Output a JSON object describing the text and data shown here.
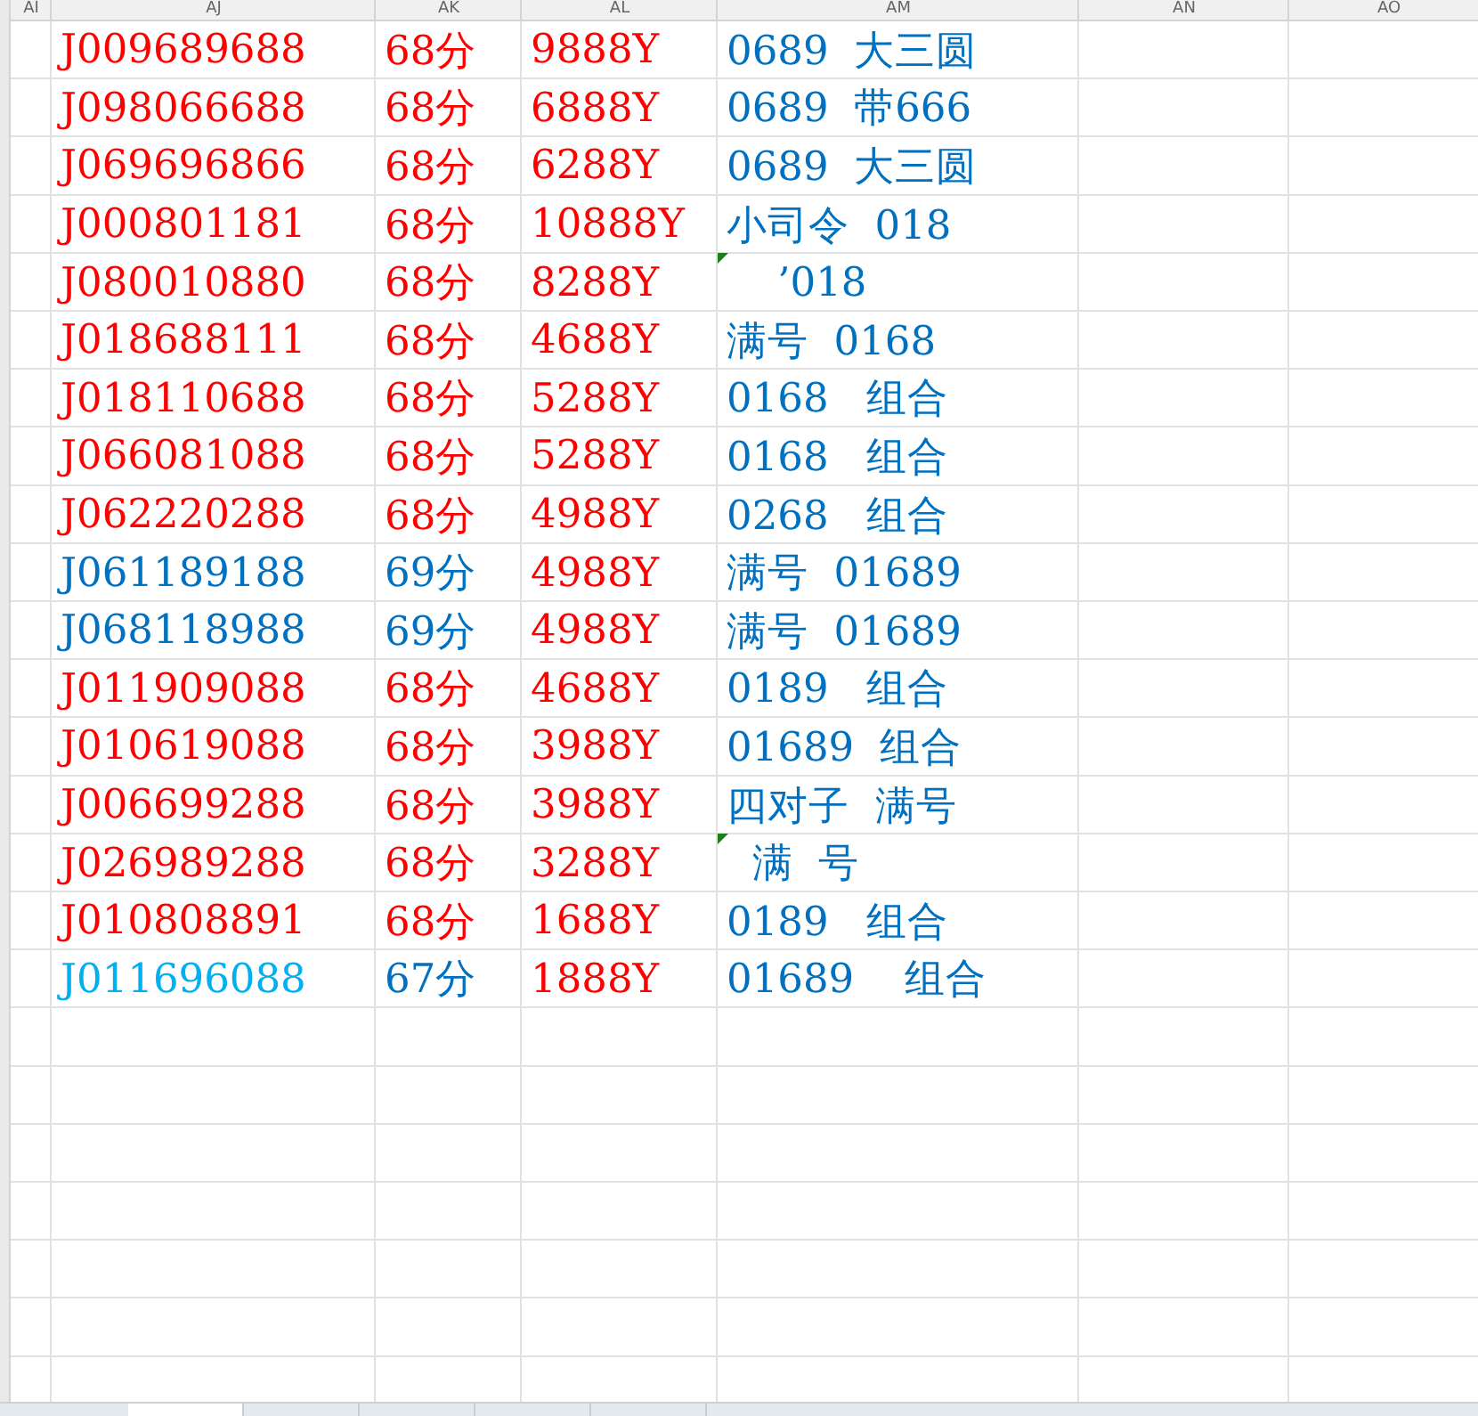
{
  "column_headers": [
    "AI",
    "AJ",
    "AK",
    "AL",
    "AM",
    "AN",
    "AO"
  ],
  "rows": [
    {
      "cells": [
        {
          "text": "J009689688",
          "color": "#ff0000"
        },
        {
          "text": "68分",
          "color": "#ff0000"
        },
        {
          "text": "9888Y",
          "color": "#ff0000"
        },
        {
          "text": "0689  大三圆",
          "color": "#0070c0",
          "flag": false
        }
      ]
    },
    {
      "cells": [
        {
          "text": "J098066688",
          "color": "#ff0000"
        },
        {
          "text": "68分",
          "color": "#ff0000"
        },
        {
          "text": "6888Y",
          "color": "#ff0000"
        },
        {
          "text": "0689  带666",
          "color": "#0070c0",
          "flag": false
        }
      ]
    },
    {
      "cells": [
        {
          "text": "J069696866",
          "color": "#ff0000"
        },
        {
          "text": "68分",
          "color": "#ff0000"
        },
        {
          "text": "6288Y",
          "color": "#ff0000"
        },
        {
          "text": "0689  大三圆",
          "color": "#0070c0",
          "flag": false
        }
      ]
    },
    {
      "cells": [
        {
          "text": "J000801181",
          "color": "#ff0000"
        },
        {
          "text": "68分",
          "color": "#ff0000"
        },
        {
          "text": "10888Y",
          "color": "#ff0000"
        },
        {
          "text": "小司令  018",
          "color": "#0070c0",
          "flag": false
        }
      ]
    },
    {
      "cells": [
        {
          "text": "J080010880",
          "color": "#ff0000"
        },
        {
          "text": "68分",
          "color": "#ff0000"
        },
        {
          "text": "8288Y",
          "color": "#ff0000"
        },
        {
          "text": "    ’018",
          "color": "#0070c0",
          "flag": true
        }
      ]
    },
    {
      "cells": [
        {
          "text": "J018688111",
          "color": "#ff0000"
        },
        {
          "text": "68分",
          "color": "#ff0000"
        },
        {
          "text": "4688Y",
          "color": "#ff0000"
        },
        {
          "text": "满号  0168",
          "color": "#0070c0",
          "flag": false
        }
      ]
    },
    {
      "cells": [
        {
          "text": "J018110688",
          "color": "#ff0000"
        },
        {
          "text": "68分",
          "color": "#ff0000"
        },
        {
          "text": "5288Y",
          "color": "#ff0000"
        },
        {
          "text": "0168   组合",
          "color": "#0070c0",
          "flag": false
        }
      ]
    },
    {
      "cells": [
        {
          "text": "J066081088",
          "color": "#ff0000"
        },
        {
          "text": "68分",
          "color": "#ff0000"
        },
        {
          "text": "5288Y",
          "color": "#ff0000"
        },
        {
          "text": "0168   组合",
          "color": "#0070c0",
          "flag": false
        }
      ]
    },
    {
      "cells": [
        {
          "text": "J062220288",
          "color": "#ff0000"
        },
        {
          "text": "68分",
          "color": "#ff0000"
        },
        {
          "text": "4988Y",
          "color": "#ff0000"
        },
        {
          "text": "0268   组合",
          "color": "#0070c0",
          "flag": false
        }
      ]
    },
    {
      "cells": [
        {
          "text": "J061189188",
          "color": "#0070c0"
        },
        {
          "text": "69分",
          "color": "#0070c0"
        },
        {
          "text": "4988Y",
          "color": "#ff0000"
        },
        {
          "text": "满号  01689",
          "color": "#0070c0",
          "flag": false
        }
      ]
    },
    {
      "cells": [
        {
          "text": "J068118988",
          "color": "#0070c0"
        },
        {
          "text": "69分",
          "color": "#0070c0"
        },
        {
          "text": "4988Y",
          "color": "#ff0000"
        },
        {
          "text": "满号  01689",
          "color": "#0070c0",
          "flag": false
        }
      ]
    },
    {
      "cells": [
        {
          "text": "J011909088",
          "color": "#ff0000"
        },
        {
          "text": "68分",
          "color": "#ff0000"
        },
        {
          "text": "4688Y",
          "color": "#ff0000"
        },
        {
          "text": "0189   组合",
          "color": "#0070c0",
          "flag": false
        }
      ]
    },
    {
      "cells": [
        {
          "text": "J010619088",
          "color": "#ff0000"
        },
        {
          "text": "68分",
          "color": "#ff0000"
        },
        {
          "text": "3988Y",
          "color": "#ff0000"
        },
        {
          "text": "01689  组合",
          "color": "#0070c0",
          "flag": false
        }
      ]
    },
    {
      "cells": [
        {
          "text": "J006699288",
          "color": "#ff0000"
        },
        {
          "text": "68分",
          "color": "#ff0000"
        },
        {
          "text": "3988Y",
          "color": "#ff0000"
        },
        {
          "text": "四对子  满号",
          "color": "#0070c0",
          "flag": false
        }
      ]
    },
    {
      "cells": [
        {
          "text": "J026989288",
          "color": "#ff0000"
        },
        {
          "text": "68分",
          "color": "#ff0000"
        },
        {
          "text": "3288Y",
          "color": "#ff0000"
        },
        {
          "text": "  满  号",
          "color": "#0070c0",
          "flag": true
        }
      ]
    },
    {
      "cells": [
        {
          "text": "J010808891",
          "color": "#ff0000"
        },
        {
          "text": "68分",
          "color": "#ff0000"
        },
        {
          "text": "1688Y",
          "color": "#ff0000"
        },
        {
          "text": "0189   组合",
          "color": "#0070c0",
          "flag": false
        }
      ]
    },
    {
      "cells": [
        {
          "text": "J011696088",
          "color": "#00b0f0"
        },
        {
          "text": "67分",
          "color": "#0070c0"
        },
        {
          "text": "1888Y",
          "color": "#ff0000"
        },
        {
          "text": "01689    组合",
          "color": "#0070c0",
          "flag": false
        }
      ]
    }
  ],
  "sheet_tabs": [
    {
      "selected": true
    },
    {
      "selected": false
    },
    {
      "selected": false
    },
    {
      "selected": false
    },
    {
      "selected": false
    }
  ]
}
